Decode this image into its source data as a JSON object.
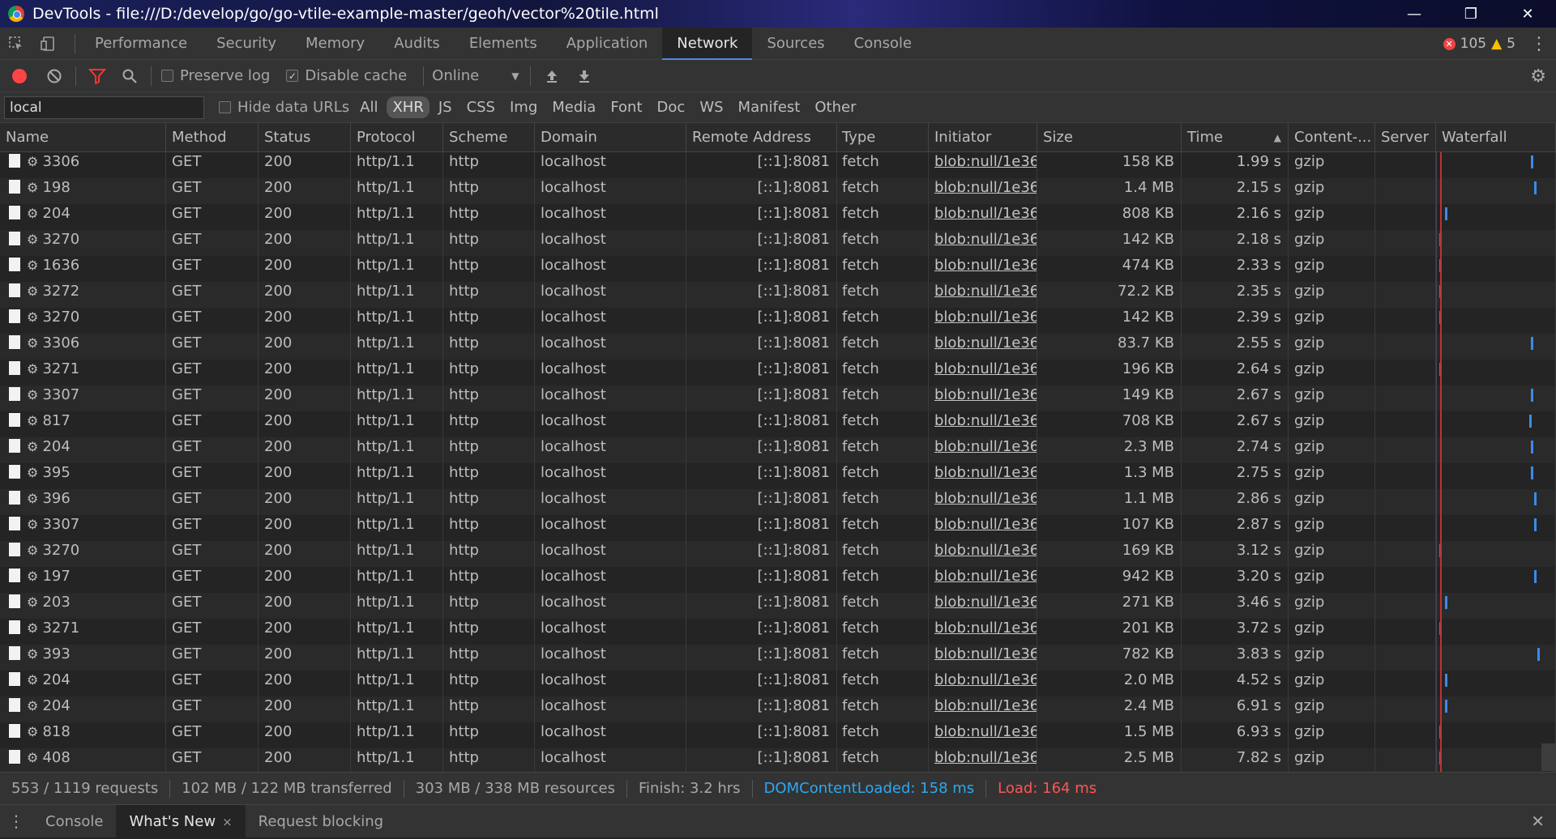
{
  "window": {
    "title": "DevTools - file:///D:/develop/go/go-vtile-example-master/geoh/vector%20tile.html",
    "minimize": "—",
    "restore": "❐",
    "close": "✕"
  },
  "tabs": [
    "Performance",
    "Security",
    "Memory",
    "Audits",
    "Elements",
    "Application",
    "Network",
    "Sources",
    "Console"
  ],
  "active_tab": "Network",
  "counts": {
    "errors": "105",
    "warnings": "5"
  },
  "toolbar": {
    "preserve_log": "Preserve log",
    "disable_cache": "Disable cache",
    "throttle": "Online",
    "throttle_arrow": "▼"
  },
  "filter": {
    "value": "local",
    "hide_data_urls": "Hide data URLs",
    "types": [
      "All",
      "XHR",
      "JS",
      "CSS",
      "Img",
      "Media",
      "Font",
      "Doc",
      "WS",
      "Manifest",
      "Other"
    ],
    "active_type": "XHR"
  },
  "columns": [
    "Name",
    "Method",
    "Status",
    "Protocol",
    "Scheme",
    "Domain",
    "Remote Address",
    "Type",
    "Initiator",
    "Size",
    "Time",
    "Content-...",
    "Server",
    "Waterfall"
  ],
  "sort_indicator": "▲",
  "rows": [
    {
      "name": "3306",
      "method": "GET",
      "status": "200",
      "protocol": "http/1.1",
      "scheme": "http",
      "domain": "localhost",
      "remote": "[::1]:8081",
      "type": "fetch",
      "initiator": "blob:null/1e36...",
      "size": "158 KB",
      "time": "1.99 s",
      "content": "gzip"
    },
    {
      "name": "198",
      "method": "GET",
      "status": "200",
      "protocol": "http/1.1",
      "scheme": "http",
      "domain": "localhost",
      "remote": "[::1]:8081",
      "type": "fetch",
      "initiator": "blob:null/1e36...",
      "size": "1.4 MB",
      "time": "2.15 s",
      "content": "gzip"
    },
    {
      "name": "204",
      "method": "GET",
      "status": "200",
      "protocol": "http/1.1",
      "scheme": "http",
      "domain": "localhost",
      "remote": "[::1]:8081",
      "type": "fetch",
      "initiator": "blob:null/1e36...",
      "size": "808 KB",
      "time": "2.16 s",
      "content": "gzip"
    },
    {
      "name": "3270",
      "method": "GET",
      "status": "200",
      "protocol": "http/1.1",
      "scheme": "http",
      "domain": "localhost",
      "remote": "[::1]:8081",
      "type": "fetch",
      "initiator": "blob:null/1e36...",
      "size": "142 KB",
      "time": "2.18 s",
      "content": "gzip"
    },
    {
      "name": "1636",
      "method": "GET",
      "status": "200",
      "protocol": "http/1.1",
      "scheme": "http",
      "domain": "localhost",
      "remote": "[::1]:8081",
      "type": "fetch",
      "initiator": "blob:null/1e36...",
      "size": "474 KB",
      "time": "2.33 s",
      "content": "gzip"
    },
    {
      "name": "3272",
      "method": "GET",
      "status": "200",
      "protocol": "http/1.1",
      "scheme": "http",
      "domain": "localhost",
      "remote": "[::1]:8081",
      "type": "fetch",
      "initiator": "blob:null/1e36...",
      "size": "72.2 KB",
      "time": "2.35 s",
      "content": "gzip"
    },
    {
      "name": "3270",
      "method": "GET",
      "status": "200",
      "protocol": "http/1.1",
      "scheme": "http",
      "domain": "localhost",
      "remote": "[::1]:8081",
      "type": "fetch",
      "initiator": "blob:null/1e36...",
      "size": "142 KB",
      "time": "2.39 s",
      "content": "gzip"
    },
    {
      "name": "3306",
      "method": "GET",
      "status": "200",
      "protocol": "http/1.1",
      "scheme": "http",
      "domain": "localhost",
      "remote": "[::1]:8081",
      "type": "fetch",
      "initiator": "blob:null/1e36...",
      "size": "83.7 KB",
      "time": "2.55 s",
      "content": "gzip"
    },
    {
      "name": "3271",
      "method": "GET",
      "status": "200",
      "protocol": "http/1.1",
      "scheme": "http",
      "domain": "localhost",
      "remote": "[::1]:8081",
      "type": "fetch",
      "initiator": "blob:null/1e36...",
      "size": "196 KB",
      "time": "2.64 s",
      "content": "gzip"
    },
    {
      "name": "3307",
      "method": "GET",
      "status": "200",
      "protocol": "http/1.1",
      "scheme": "http",
      "domain": "localhost",
      "remote": "[::1]:8081",
      "type": "fetch",
      "initiator": "blob:null/1e36...",
      "size": "149 KB",
      "time": "2.67 s",
      "content": "gzip"
    },
    {
      "name": "817",
      "method": "GET",
      "status": "200",
      "protocol": "http/1.1",
      "scheme": "http",
      "domain": "localhost",
      "remote": "[::1]:8081",
      "type": "fetch",
      "initiator": "blob:null/1e36...",
      "size": "708 KB",
      "time": "2.67 s",
      "content": "gzip"
    },
    {
      "name": "204",
      "method": "GET",
      "status": "200",
      "protocol": "http/1.1",
      "scheme": "http",
      "domain": "localhost",
      "remote": "[::1]:8081",
      "type": "fetch",
      "initiator": "blob:null/1e36...",
      "size": "2.3 MB",
      "time": "2.74 s",
      "content": "gzip"
    },
    {
      "name": "395",
      "method": "GET",
      "status": "200",
      "protocol": "http/1.1",
      "scheme": "http",
      "domain": "localhost",
      "remote": "[::1]:8081",
      "type": "fetch",
      "initiator": "blob:null/1e36...",
      "size": "1.3 MB",
      "time": "2.75 s",
      "content": "gzip"
    },
    {
      "name": "396",
      "method": "GET",
      "status": "200",
      "protocol": "http/1.1",
      "scheme": "http",
      "domain": "localhost",
      "remote": "[::1]:8081",
      "type": "fetch",
      "initiator": "blob:null/1e36...",
      "size": "1.1 MB",
      "time": "2.86 s",
      "content": "gzip"
    },
    {
      "name": "3307",
      "method": "GET",
      "status": "200",
      "protocol": "http/1.1",
      "scheme": "http",
      "domain": "localhost",
      "remote": "[::1]:8081",
      "type": "fetch",
      "initiator": "blob:null/1e36...",
      "size": "107 KB",
      "time": "2.87 s",
      "content": "gzip"
    },
    {
      "name": "3270",
      "method": "GET",
      "status": "200",
      "protocol": "http/1.1",
      "scheme": "http",
      "domain": "localhost",
      "remote": "[::1]:8081",
      "type": "fetch",
      "initiator": "blob:null/1e36...",
      "size": "169 KB",
      "time": "3.12 s",
      "content": "gzip"
    },
    {
      "name": "197",
      "method": "GET",
      "status": "200",
      "protocol": "http/1.1",
      "scheme": "http",
      "domain": "localhost",
      "remote": "[::1]:8081",
      "type": "fetch",
      "initiator": "blob:null/1e36...",
      "size": "942 KB",
      "time": "3.20 s",
      "content": "gzip"
    },
    {
      "name": "203",
      "method": "GET",
      "status": "200",
      "protocol": "http/1.1",
      "scheme": "http",
      "domain": "localhost",
      "remote": "[::1]:8081",
      "type": "fetch",
      "initiator": "blob:null/1e36...",
      "size": "271 KB",
      "time": "3.46 s",
      "content": "gzip"
    },
    {
      "name": "3271",
      "method": "GET",
      "status": "200",
      "protocol": "http/1.1",
      "scheme": "http",
      "domain": "localhost",
      "remote": "[::1]:8081",
      "type": "fetch",
      "initiator": "blob:null/1e36...",
      "size": "201 KB",
      "time": "3.72 s",
      "content": "gzip"
    },
    {
      "name": "393",
      "method": "GET",
      "status": "200",
      "protocol": "http/1.1",
      "scheme": "http",
      "domain": "localhost",
      "remote": "[::1]:8081",
      "type": "fetch",
      "initiator": "blob:null/1e36...",
      "size": "782 KB",
      "time": "3.83 s",
      "content": "gzip"
    },
    {
      "name": "204",
      "method": "GET",
      "status": "200",
      "protocol": "http/1.1",
      "scheme": "http",
      "domain": "localhost",
      "remote": "[::1]:8081",
      "type": "fetch",
      "initiator": "blob:null/1e36...",
      "size": "2.0 MB",
      "time": "4.52 s",
      "content": "gzip"
    },
    {
      "name": "204",
      "method": "GET",
      "status": "200",
      "protocol": "http/1.1",
      "scheme": "http",
      "domain": "localhost",
      "remote": "[::1]:8081",
      "type": "fetch",
      "initiator": "blob:null/1e36...",
      "size": "2.4 MB",
      "time": "6.91 s",
      "content": "gzip"
    },
    {
      "name": "818",
      "method": "GET",
      "status": "200",
      "protocol": "http/1.1",
      "scheme": "http",
      "domain": "localhost",
      "remote": "[::1]:8081",
      "type": "fetch",
      "initiator": "blob:null/1e36...",
      "size": "1.5 MB",
      "time": "6.93 s",
      "content": "gzip"
    },
    {
      "name": "408",
      "method": "GET",
      "status": "200",
      "protocol": "http/1.1",
      "scheme": "http",
      "domain": "localhost",
      "remote": "[::1]:8081",
      "type": "fetch",
      "initiator": "blob:null/1e36...",
      "size": "2.5 MB",
      "time": "7.82 s",
      "content": "gzip"
    }
  ],
  "status": {
    "requests": "553 / 1119 requests",
    "transferred": "102 MB / 122 MB transferred",
    "resources": "303 MB / 338 MB resources",
    "finish": "Finish: 3.2 hrs",
    "dcl": "DOMContentLoaded: 158 ms",
    "load": "Load: 164 ms"
  },
  "drawer": {
    "tabs": [
      "Console",
      "What's New",
      "Request blocking"
    ],
    "active_tab": "What's New",
    "close_tab": "×",
    "close": "✕"
  },
  "colors": {
    "accent": "#4d8ae0",
    "dcl": "#2ea8f0",
    "load": "#ff5555",
    "record": "#ff4444"
  }
}
